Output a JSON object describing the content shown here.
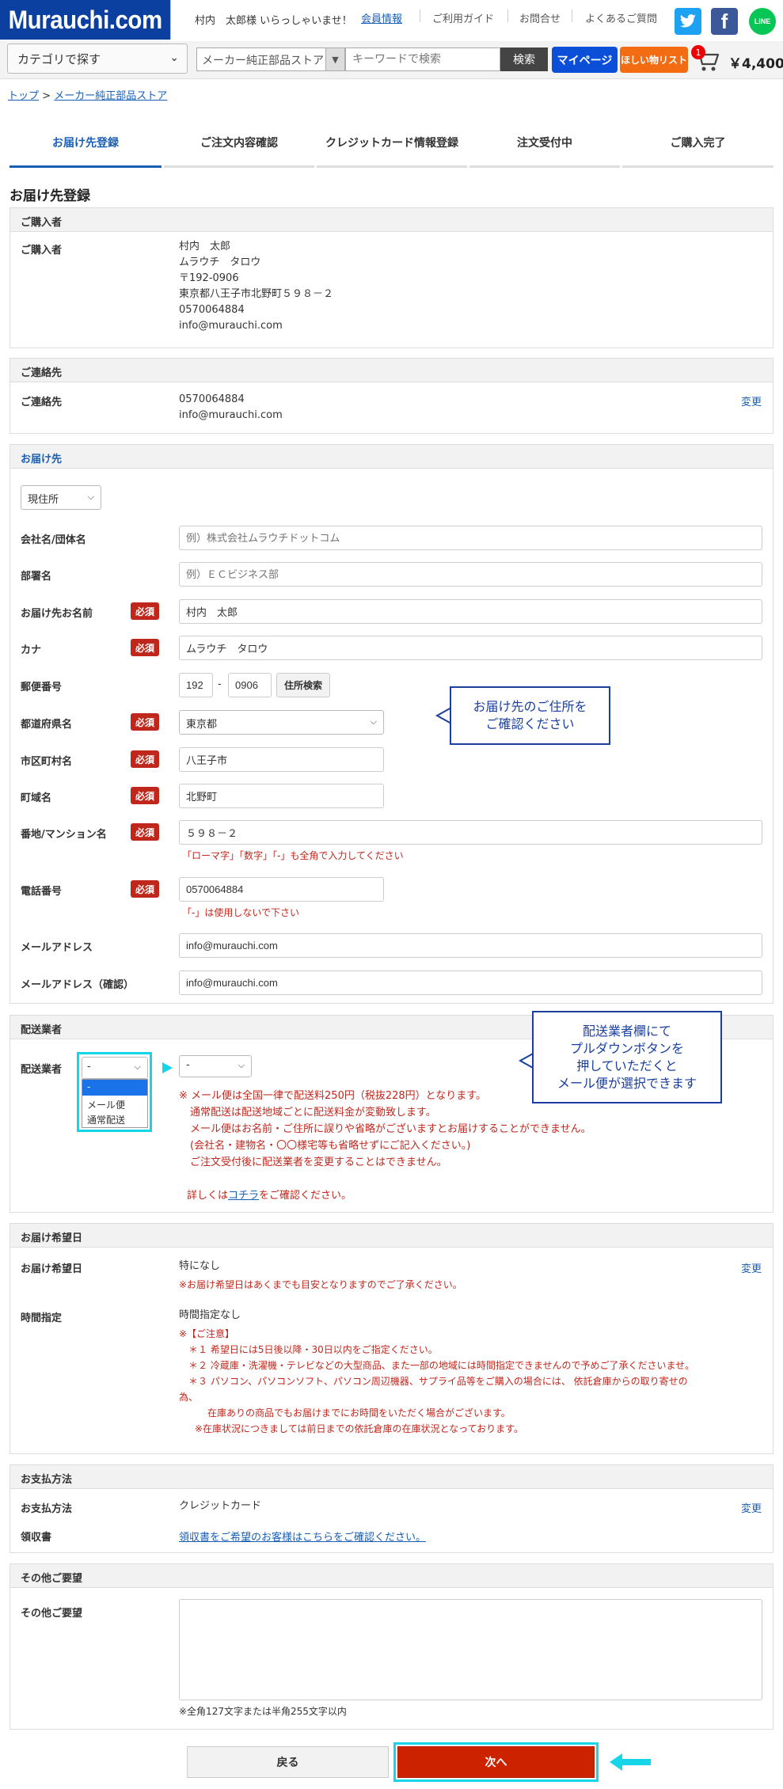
{
  "header": {
    "logo": "Murauchi.com",
    "welcome": "村内　太郎様 いらっしゃいませ！",
    "user_name": "村内",
    "links": [
      "会員情報",
      "ご利用ガイド",
      "お問合せ",
      "よくあるご質問"
    ],
    "category_button": "カテゴリで探す",
    "maker_select": "メーカー純正部品ストア",
    "search_placeholder": "キーワードで検索",
    "search_button": "検索",
    "mypage": "マイページ",
    "wishlist": "ほしい物リスト",
    "cart_count": "1",
    "cart_price": "￥4,400",
    "social": {
      "twitter": "t",
      "facebook": "f",
      "line": "LINE"
    }
  },
  "breadcrumb": [
    "トップ",
    "メーカー純正部品ストア"
  ],
  "steps": [
    {
      "label": "お届け先登録",
      "active": true
    },
    {
      "label": "ご注文内容確認",
      "active": false
    },
    {
      "label": "クレジットカード情報登録",
      "active": false
    },
    {
      "label": "注文受付中",
      "active": false
    },
    {
      "label": "ご購入完了",
      "active": false
    }
  ],
  "page_title": "お届け先登録",
  "purchaser": {
    "heading": "ご購入者",
    "label": "ご購入者",
    "lines": [
      "村内　太郎",
      "ムラウチ　タロウ",
      "〒192-0906",
      "東京都八王子市北野町５９８－２",
      "0570064884",
      "info@murauchi.com"
    ]
  },
  "contact": {
    "heading": "ご連絡先",
    "label": "ご連絡先",
    "lines": [
      "0570064884",
      "info@murauchi.com"
    ],
    "change": "変更"
  },
  "delivery": {
    "heading": "お届け先",
    "address_type": "現住所",
    "required": "必須",
    "company_label": "会社名/団体名",
    "company_placeholder": "例）株式会社ムラウチドットコム",
    "dept_label": "部署名",
    "dept_placeholder": "例）ＥＣビジネス部",
    "name_label": "お届け先お名前",
    "name_value": "村内　太郎",
    "kana_label": "カナ",
    "kana_value": "ムラウチ　タロウ",
    "zip_label": "郵便番号",
    "zip1": "192",
    "zip_dash": "-",
    "zip2": "0906",
    "zip_search": "住所検索",
    "pref_label": "都道府県名",
    "pref_value": "東京都",
    "city_label": "市区町村名",
    "city_value": "八王子市",
    "town_label": "町域名",
    "town_value": "北野町",
    "street_label": "番地/マンション名",
    "street_value": "５９８－２",
    "street_note": "「ローマ字」「数字」「-」も全角で入力してください",
    "tel_label": "電話番号",
    "tel_value": "0570064884",
    "tel_note": "「-」は使用しないで下さい",
    "mail_label": "メールアドレス",
    "mail_value": "info@murauchi.com",
    "mail2_label": "メールアドレス（確認）",
    "mail2_value": "info@murauchi.com",
    "callout": [
      "お届け先のご住所を",
      "ご確認ください"
    ]
  },
  "carrier": {
    "heading": "配送業者",
    "label": "配送業者",
    "select_value": "-",
    "options": [
      "-",
      "メール便",
      "通常配送"
    ],
    "second_select": "-",
    "notes": [
      "※ メール便は全国一律で配送料250円（税抜228円）となります。",
      "通常配送は配送地域ごとに配送料金が変動致します。",
      "メール便はお名前・ご住所に誤りや省略がございますとお届けすることができません。",
      "(会社名・建物名・〇〇様宅等も省略せずにご記入ください。)",
      "ご注文受付後に配送業者を変更することはできません。"
    ],
    "detail_prefix": "詳しくは",
    "detail_link": "コチラ",
    "detail_suffix": "をご確認ください。",
    "callout": [
      "配送業者欄にて",
      "プルダウンボタンを",
      "押していただくと",
      "メール便が選択できます"
    ]
  },
  "desired_date": {
    "heading": "お届け希望日",
    "label": "お届け希望日",
    "value": "特になし",
    "note": "※お届け希望日はあくまでも目安となりますのでご了承ください。",
    "change": "変更",
    "time_label": "時間指定",
    "time_value": "時間指定なし",
    "caution_title": "※【ご注意】",
    "cautions": [
      "＊１ 希望日には5日後以降・30日以内をご指定ください。",
      "＊２ 冷蔵庫・洗濯機・テレビなどの大型商品、また一部の地域には時間指定できませんので予めご了承くださいませ。",
      "＊３ パソコン、パソコンソフト、パソコン周辺機器、サプライ品等をご購入の場合には、 依託倉庫からの取り寄せの",
      "為、",
      "在庫ありの商品でもお届けまでにお時間をいただく場合がございます。",
      "※在庫状況につきましては前日までの依託倉庫の在庫状況となっております。"
    ]
  },
  "payment": {
    "heading": "お支払方法",
    "label": "お支払方法",
    "value": "クレジットカード",
    "change": "変更",
    "receipt_label": "領収書",
    "receipt_link": "領収書をご希望のお客様はこちらをご確認ください。"
  },
  "requests": {
    "heading": "その他ご要望",
    "label": "その他ご要望",
    "note": "※全角127文字または半角255文字以内"
  },
  "buttons": {
    "back": "戻る",
    "next": "次へ"
  }
}
